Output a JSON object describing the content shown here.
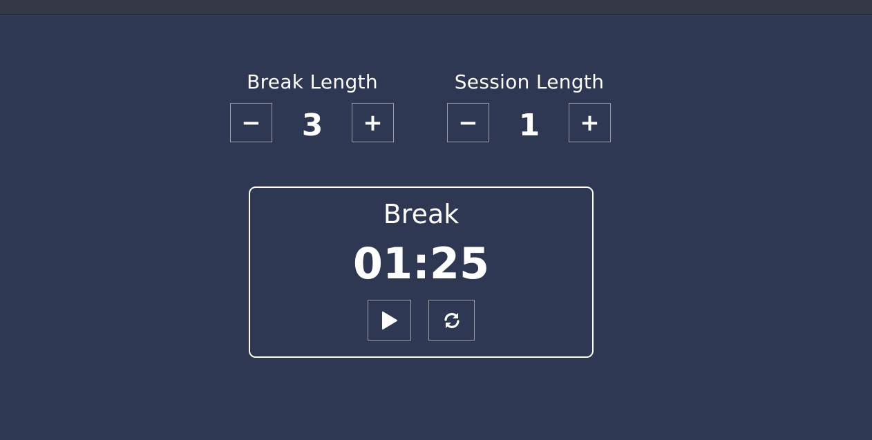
{
  "break": {
    "label": "Break Length",
    "value": "3",
    "decrement_label": "−",
    "increment_label": "+"
  },
  "session": {
    "label": "Session Length",
    "value": "1",
    "decrement_label": "−",
    "increment_label": "+"
  },
  "timer": {
    "label": "Break",
    "time": "01:25",
    "play_icon": "play-icon",
    "reset_icon": "refresh-icon"
  },
  "colors": {
    "background": "#2f3852",
    "topbar": "#353946",
    "text": "#ffffff",
    "button_border": "#9aa0a6"
  }
}
